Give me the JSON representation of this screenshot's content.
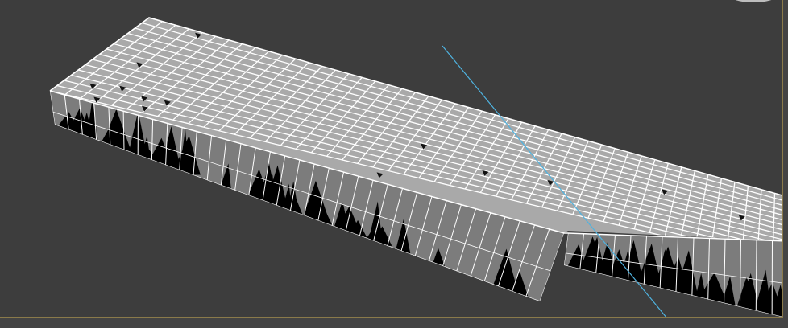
{
  "viewport": {
    "background": "#3d3d3d",
    "border_color": "#8a7a4a",
    "mesh_top_color": "#a9a9a9",
    "mesh_side_color": "#7c7c7c",
    "wire_color": "#ffffff",
    "helper_line_color": "#4fb3e0"
  }
}
